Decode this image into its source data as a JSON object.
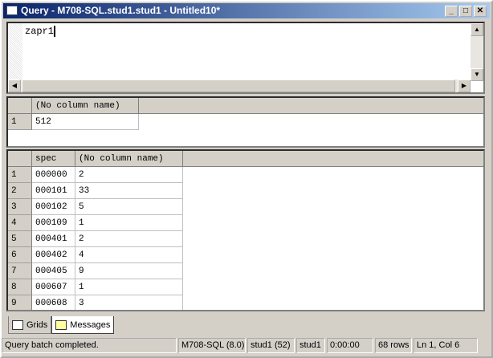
{
  "window": {
    "title": "Query - M708-SQL.stud1.stud1 - Untitled10*",
    "min": "_",
    "max": "□",
    "close": "✕"
  },
  "editor": {
    "text": "zapr1"
  },
  "grid1": {
    "columns": [
      "(No column name)"
    ],
    "rows": [
      [
        "1",
        "512"
      ]
    ]
  },
  "grid2": {
    "columns": [
      "spec",
      "(No column name)"
    ],
    "rows": [
      [
        "1",
        "000000",
        "2"
      ],
      [
        "2",
        "000101",
        "33"
      ],
      [
        "3",
        "000102",
        "5"
      ],
      [
        "4",
        "000109",
        "1"
      ],
      [
        "5",
        "000401",
        "2"
      ],
      [
        "6",
        "000402",
        "4"
      ],
      [
        "7",
        "000405",
        "9"
      ],
      [
        "8",
        "000607",
        "1"
      ],
      [
        "9",
        "000608",
        "3"
      ]
    ]
  },
  "tabs": {
    "grids": "Grids",
    "messages": "Messages"
  },
  "status": {
    "message": "Query batch completed.",
    "server": "M708-SQL (8.0)",
    "user": "stud1 (52)",
    "db": "stud1",
    "time": "0:00:00",
    "rows": "68 rows",
    "position": "Ln 1, Col 6"
  }
}
